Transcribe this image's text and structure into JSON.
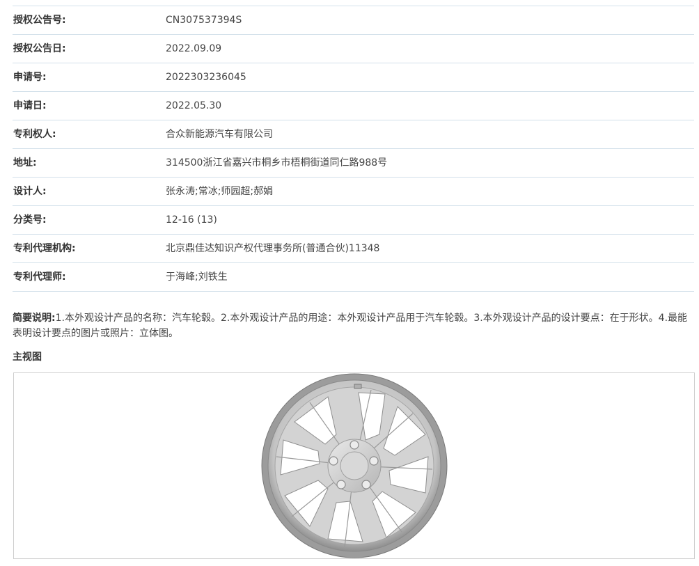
{
  "fields": [
    {
      "label": "授权公告号:",
      "value": "CN307537394S"
    },
    {
      "label": "授权公告日:",
      "value": "2022.09.09"
    },
    {
      "label": "申请号:",
      "value": "2022303236045"
    },
    {
      "label": "申请日:",
      "value": "2022.05.30"
    },
    {
      "label": "专利权人:",
      "value": "合众新能源汽车有限公司"
    },
    {
      "label": "地址:",
      "value": "314500浙江省嘉兴市桐乡市梧桐街道同仁路988号"
    },
    {
      "label": "设计人:",
      "value": "张永涛;常冰;师园超;郝娟"
    },
    {
      "label": "分类号:",
      "value": "12-16 (13)"
    },
    {
      "label": "专利代理机构:",
      "value": "北京鼎佳达知识产权代理事务所(普通合伙)11348"
    },
    {
      "label": "专利代理师:",
      "value": "于海峰;刘铁生"
    }
  ],
  "summary": {
    "label": "简要说明:",
    "text": "1.本外观设计产品的名称：汽车轮毂。2.本外观设计产品的用途：本外观设计产品用于汽车轮毂。3.本外观设计产品的设计要点：在于形状。4.最能表明设计要点的图片或照片：立体图。"
  },
  "main_view": {
    "title": "主视图"
  },
  "colors": {
    "row_border": "#d2e0ea",
    "label_text": "#333333",
    "value_text": "#444444",
    "wheel_rim": "#9c9c9c",
    "wheel_face": "#cfcfcf"
  }
}
